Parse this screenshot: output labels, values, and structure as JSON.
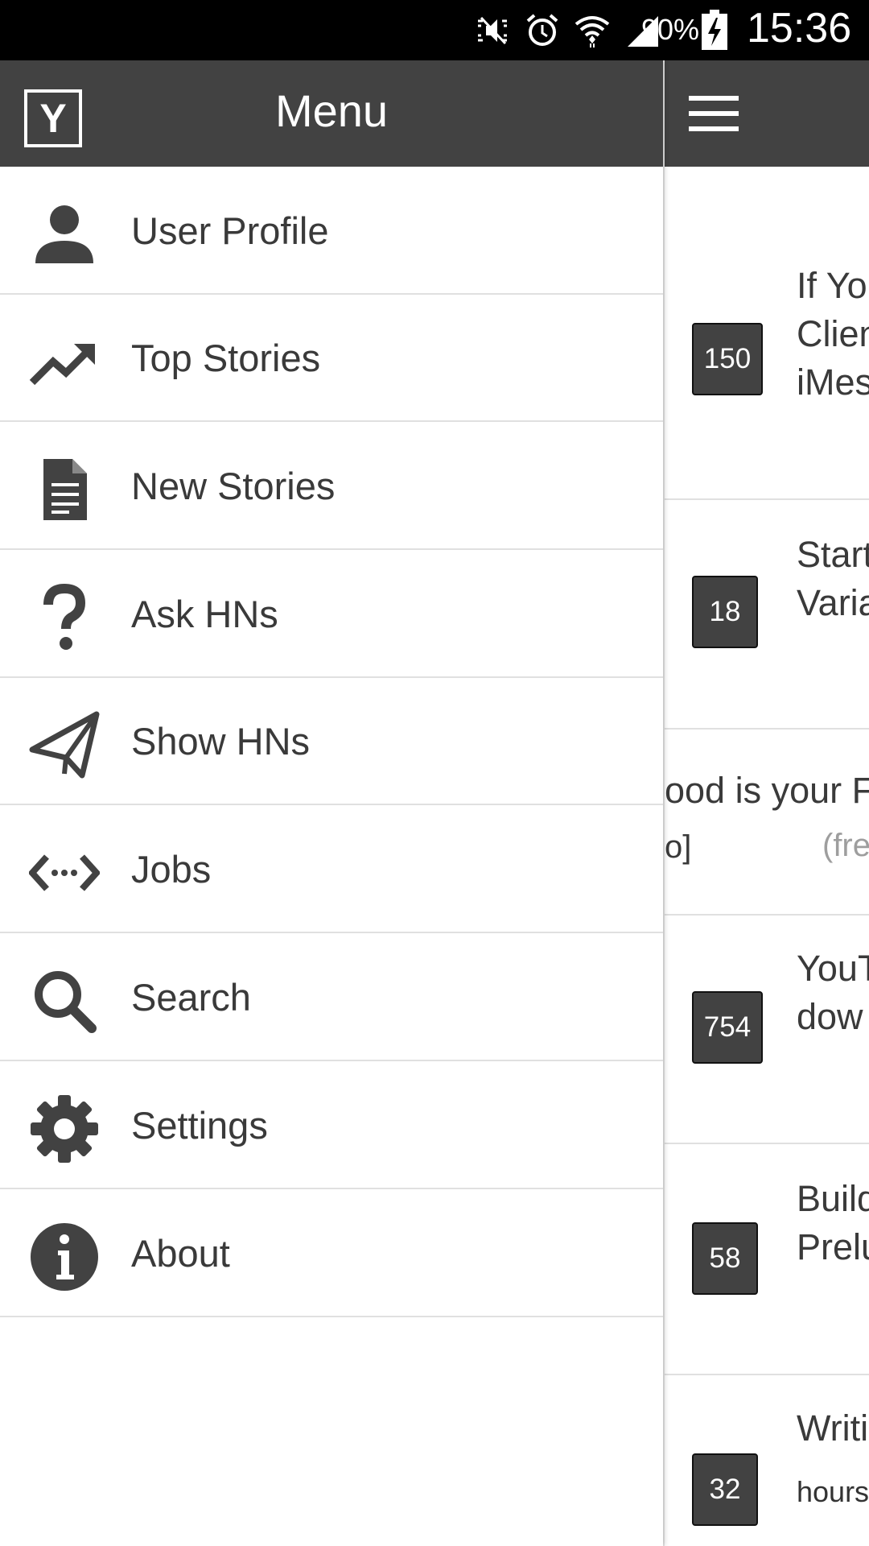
{
  "status_bar": {
    "battery": "90%",
    "time": "15:36",
    "icons": [
      "mute-vibrate-icon",
      "alarm-icon",
      "wifi-icon",
      "signal-icon",
      "battery-charging-icon"
    ]
  },
  "drawer": {
    "logo_letter": "Y",
    "title": "Menu",
    "items": [
      {
        "label": "User Profile",
        "icon": "person-icon"
      },
      {
        "label": "Top Stories",
        "icon": "trending-up-icon"
      },
      {
        "label": "New Stories",
        "icon": "document-icon"
      },
      {
        "label": "Ask HNs",
        "icon": "question-icon"
      },
      {
        "label": "Show HNs",
        "icon": "send-icon"
      },
      {
        "label": "Jobs",
        "icon": "code-icon"
      },
      {
        "label": "Search",
        "icon": "search-icon"
      },
      {
        "label": "Settings",
        "icon": "gear-icon"
      },
      {
        "label": "About",
        "icon": "info-icon"
      }
    ]
  },
  "content": {
    "stories": [
      {
        "score": "150",
        "title_lines": [
          "If Yo",
          "Clien",
          "iMes"
        ]
      },
      {
        "score": "18",
        "title_lines": [
          "Start",
          "Varia"
        ]
      },
      {
        "overflow_title": "ood is your F",
        "overflow_tag": "o]",
        "overflow_meta": "(fre"
      },
      {
        "score": "754",
        "title_lines": [
          "YouT",
          "dow"
        ]
      },
      {
        "score": "58",
        "title_lines": [
          "Build",
          "Prelu"
        ]
      },
      {
        "score": "32",
        "title_lines": [
          "Writi"
        ],
        "sub": "hours"
      }
    ],
    "meta_color": "#9e9e9e"
  },
  "colors": {
    "toolbar": "#424242",
    "badge": "#424242",
    "icon": "#424242"
  }
}
